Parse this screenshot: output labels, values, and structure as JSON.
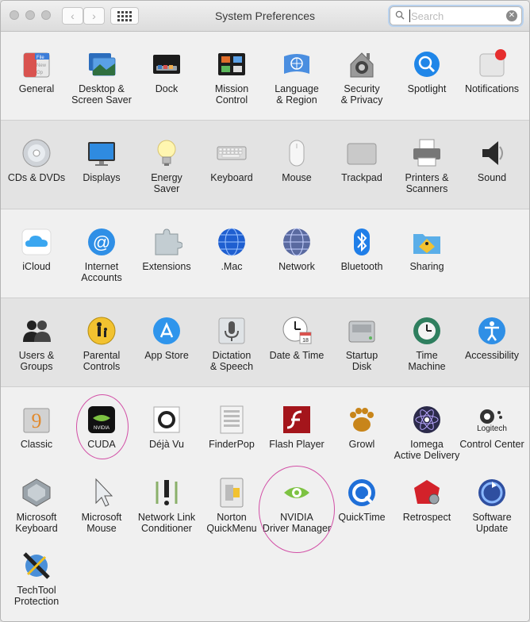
{
  "window": {
    "title": "System Preferences"
  },
  "search": {
    "placeholder": "Search"
  },
  "toolbar": {
    "back": "‹",
    "forward": "›"
  },
  "rows": [
    [
      {
        "name": "general",
        "label": "General",
        "icon": "general-icon"
      },
      {
        "name": "desktop-screen-saver",
        "label": "Desktop &\nScreen Saver",
        "icon": "desktop-screen-saver-icon"
      },
      {
        "name": "dock",
        "label": "Dock",
        "icon": "dock-icon"
      },
      {
        "name": "mission-control",
        "label": "Mission\nControl",
        "icon": "mission-control-icon"
      },
      {
        "name": "language-region",
        "label": "Language\n& Region",
        "icon": "un-flag-icon"
      },
      {
        "name": "security-privacy",
        "label": "Security\n& Privacy",
        "icon": "house-lock-icon"
      },
      {
        "name": "spotlight",
        "label": "Spotlight",
        "icon": "magnifier-icon"
      },
      {
        "name": "notifications",
        "label": "Notifications",
        "icon": "notifications-icon"
      }
    ],
    [
      {
        "name": "cds-dvds",
        "label": "CDs & DVDs",
        "icon": "disc-icon"
      },
      {
        "name": "displays",
        "label": "Displays",
        "icon": "monitor-icon"
      },
      {
        "name": "energy-saver",
        "label": "Energy\nSaver",
        "icon": "light-bulb-icon"
      },
      {
        "name": "keyboard",
        "label": "Keyboard",
        "icon": "keyboard-icon"
      },
      {
        "name": "mouse",
        "label": "Mouse",
        "icon": "mouse-icon"
      },
      {
        "name": "trackpad",
        "label": "Trackpad",
        "icon": "trackpad-icon"
      },
      {
        "name": "printers-scanners",
        "label": "Printers &\nScanners",
        "icon": "printer-icon"
      },
      {
        "name": "sound",
        "label": "Sound",
        "icon": "speaker-icon"
      }
    ],
    [
      {
        "name": "icloud",
        "label": "iCloud",
        "icon": "cloud-icon"
      },
      {
        "name": "internet-accounts",
        "label": "Internet\nAccounts",
        "icon": "at-sign-icon"
      },
      {
        "name": "extensions",
        "label": "Extensions",
        "icon": "puzzle-piece-icon"
      },
      {
        "name": "mac",
        "label": ".Mac",
        "icon": "globe-icon"
      },
      {
        "name": "network",
        "label": "Network",
        "icon": "network-globe-icon"
      },
      {
        "name": "bluetooth",
        "label": "Bluetooth",
        "icon": "bluetooth-icon"
      },
      {
        "name": "sharing",
        "label": "Sharing",
        "icon": "sharing-folder-icon"
      }
    ],
    [
      {
        "name": "users-groups",
        "label": "Users &\nGroups",
        "icon": "users-icon"
      },
      {
        "name": "parental-controls",
        "label": "Parental\nControls",
        "icon": "parental-icon"
      },
      {
        "name": "app-store",
        "label": "App Store",
        "icon": "app-store-icon"
      },
      {
        "name": "dictation-speech",
        "label": "Dictation\n& Speech",
        "icon": "microphone-icon"
      },
      {
        "name": "date-time",
        "label": "Date & Time",
        "icon": "clock-calendar-icon"
      },
      {
        "name": "startup-disk",
        "label": "Startup\nDisk",
        "icon": "hard-drive-icon"
      },
      {
        "name": "time-machine",
        "label": "Time\nMachine",
        "icon": "time-machine-icon"
      },
      {
        "name": "accessibility",
        "label": "Accessibility",
        "icon": "accessibility-icon"
      }
    ],
    [
      {
        "name": "classic",
        "label": "Classic",
        "icon": "classic-icon"
      },
      {
        "name": "cuda",
        "label": "CUDA",
        "icon": "nvidia-chip-icon"
      },
      {
        "name": "deja-vu",
        "label": "Déjà Vu",
        "icon": "deja-vu-icon"
      },
      {
        "name": "finderpop",
        "label": "FinderPop",
        "icon": "finderpop-icon"
      },
      {
        "name": "flash-player",
        "label": "Flash Player",
        "icon": "flash-icon"
      },
      {
        "name": "growl",
        "label": "Growl",
        "icon": "growl-paw-icon"
      },
      {
        "name": "iomega-active-delivery",
        "label": "Iomega\nActive Delivery",
        "icon": "atom-icon"
      },
      {
        "name": "control-center",
        "label": "Control Center",
        "icon": "logitech-icon",
        "badge": "Logitech"
      }
    ],
    [
      {
        "name": "microsoft-keyboard",
        "label": "Microsoft\nKeyboard",
        "icon": "ms-keyboard-icon"
      },
      {
        "name": "microsoft-mouse",
        "label": "Microsoft\nMouse",
        "icon": "cursor-arrow-icon"
      },
      {
        "name": "network-link-conditioner",
        "label": "Network Link\nConditioner",
        "icon": "network-link-icon"
      },
      {
        "name": "norton-quickmenu",
        "label": "Norton\nQuickMenu",
        "icon": "norton-switch-icon"
      },
      {
        "name": "nvidia-driver-manager",
        "label": "NVIDIA\nDriver Manager",
        "icon": "nvidia-eye-icon"
      },
      {
        "name": "quicktime",
        "label": "QuickTime",
        "icon": "quicktime-icon"
      },
      {
        "name": "retrospect",
        "label": "Retrospect",
        "icon": "retrospect-icon"
      },
      {
        "name": "software-update",
        "label": "Software\nUpdate",
        "icon": "software-update-icon"
      }
    ],
    [
      {
        "name": "techtool-protection",
        "label": "TechTool\nProtection",
        "icon": "techtool-icon"
      }
    ]
  ]
}
